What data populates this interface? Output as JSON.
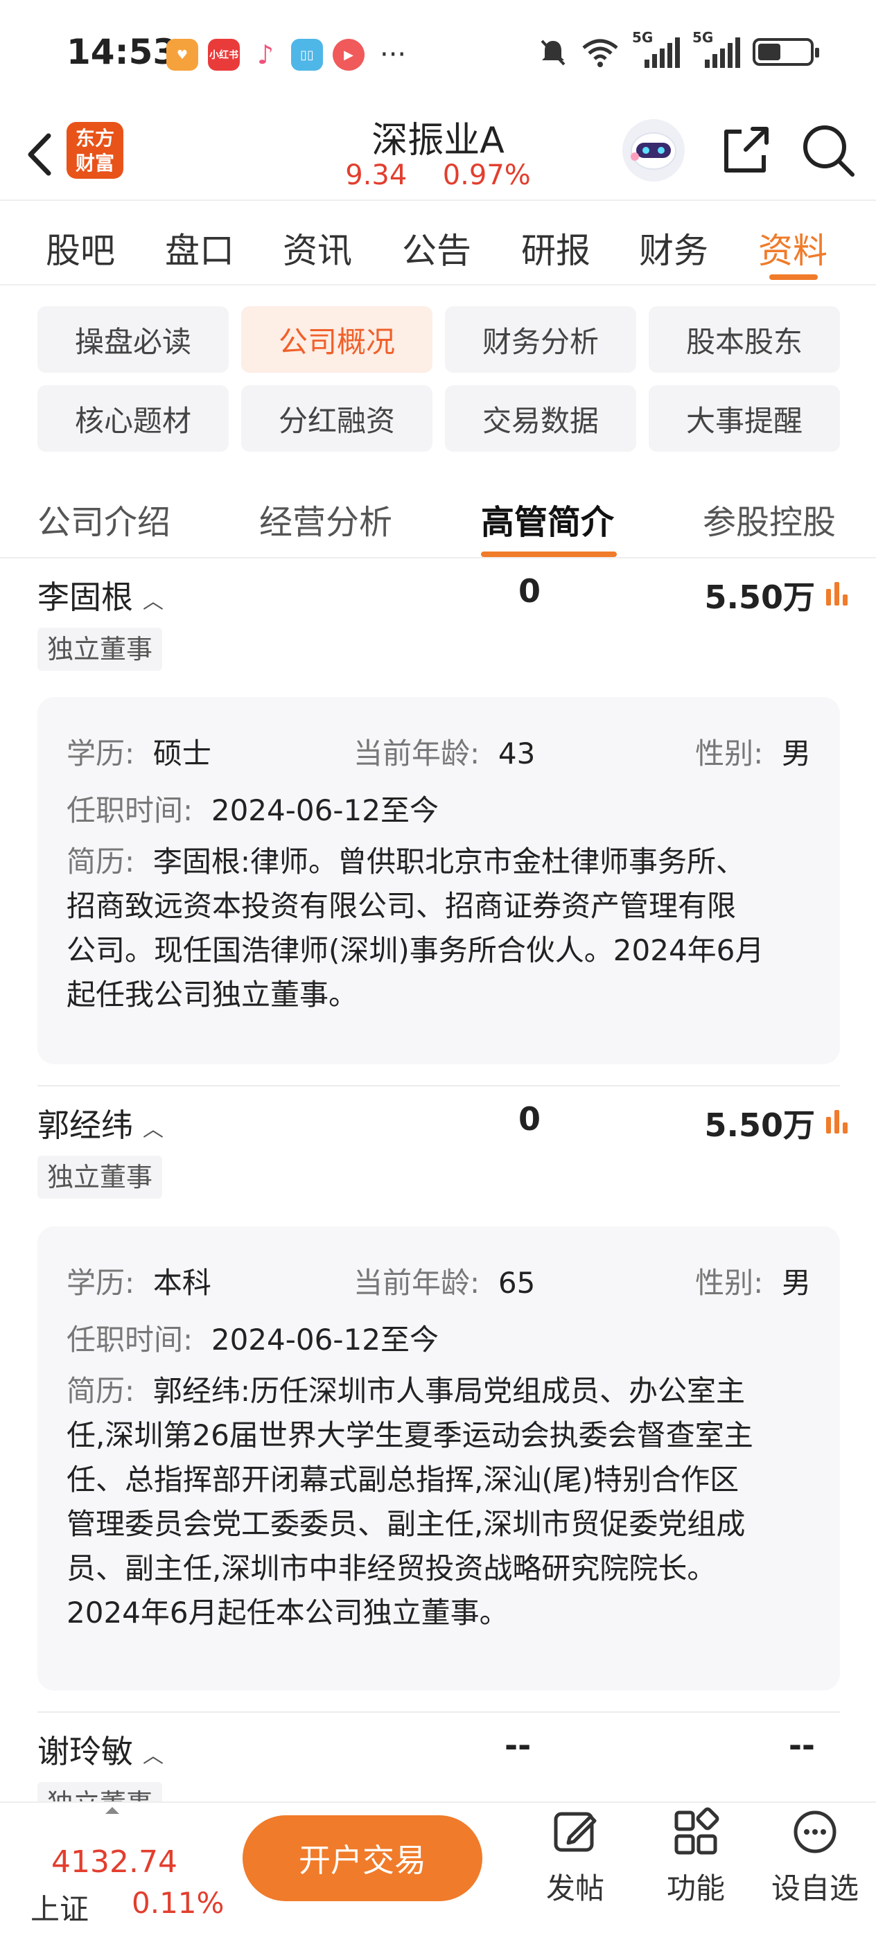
{
  "status_bar": {
    "time": "14:53",
    "app_icons": [
      "taobao-icon",
      "xiaohongshu-icon",
      "music-icon",
      "reader-icon",
      "video-icon"
    ],
    "xiaohongshu_text": "小红书",
    "more": "···",
    "network": [
      "5G",
      "5G"
    ],
    "battery_level": 0.45
  },
  "header": {
    "logo_text": "东方财富",
    "title": "深振业A",
    "price": "9.34",
    "change": "0.97%"
  },
  "tabs": [
    "股吧",
    "盘口",
    "资讯",
    "公告",
    "研报",
    "财务",
    "资料"
  ],
  "active_tab": "资料",
  "chips": [
    "操盘必读",
    "公司概况",
    "财务分析",
    "股本股东",
    "核心题材",
    "分红融资",
    "交易数据",
    "大事提醒"
  ],
  "active_chip": "公司概况",
  "subtabs": [
    "公司介绍",
    "经营分析",
    "高管简介",
    "参股控股"
  ],
  "active_subtab": "高管简介",
  "labels": {
    "education": "学历:",
    "age": "当前年龄:",
    "gender": "性别:",
    "tenure": "任职时间:",
    "bio": "简历:"
  },
  "executives": [
    {
      "name": "李固根",
      "shares": "0",
      "salary": "5.50万",
      "role": "独立董事",
      "education": "硕士",
      "age": "43",
      "gender": "男",
      "tenure": "2024-06-12至今",
      "bio_lines": [
        "李固根:律师。曾供职北京市金杜律师事务所、",
        "招商致远资本投资有限公司、招商证券资产管理有限",
        "公司。现任国浩律师(深圳)事务所合伙人。2024年6月",
        "起任我公司独立董事。"
      ]
    },
    {
      "name": "郭经纬",
      "shares": "0",
      "salary": "5.50万",
      "role": "独立董事",
      "education": "本科",
      "age": "65",
      "gender": "男",
      "tenure": "2024-06-12至今",
      "bio_lines": [
        "郭经纬:历任深圳市人事局党组成员、办公室主",
        "任,深圳第26届世界大学生夏季运动会执委会督查室主",
        "任、总指挥部开闭幕式副总指挥,深汕(尾)特别合作区",
        "管理委员会党工委委员、副主任,深圳市贸促委党组成",
        "员、副主任,深圳市中非经贸投资战略研究院院长。",
        "2024年6月起任本公司独立董事。"
      ]
    },
    {
      "name": "谢玲敏",
      "shares": "--",
      "salary": "--",
      "role": "独立董事"
    }
  ],
  "bottom_bar": {
    "index_value": "4132.74",
    "index_name": "上证",
    "index_change": "0.11%",
    "trade_button": "开户交易",
    "items": [
      "发帖",
      "功能",
      "设自选"
    ]
  },
  "colors": {
    "accent": "#f07b2a",
    "up": "#e23e2e",
    "logo_bg": "#e8531a"
  }
}
